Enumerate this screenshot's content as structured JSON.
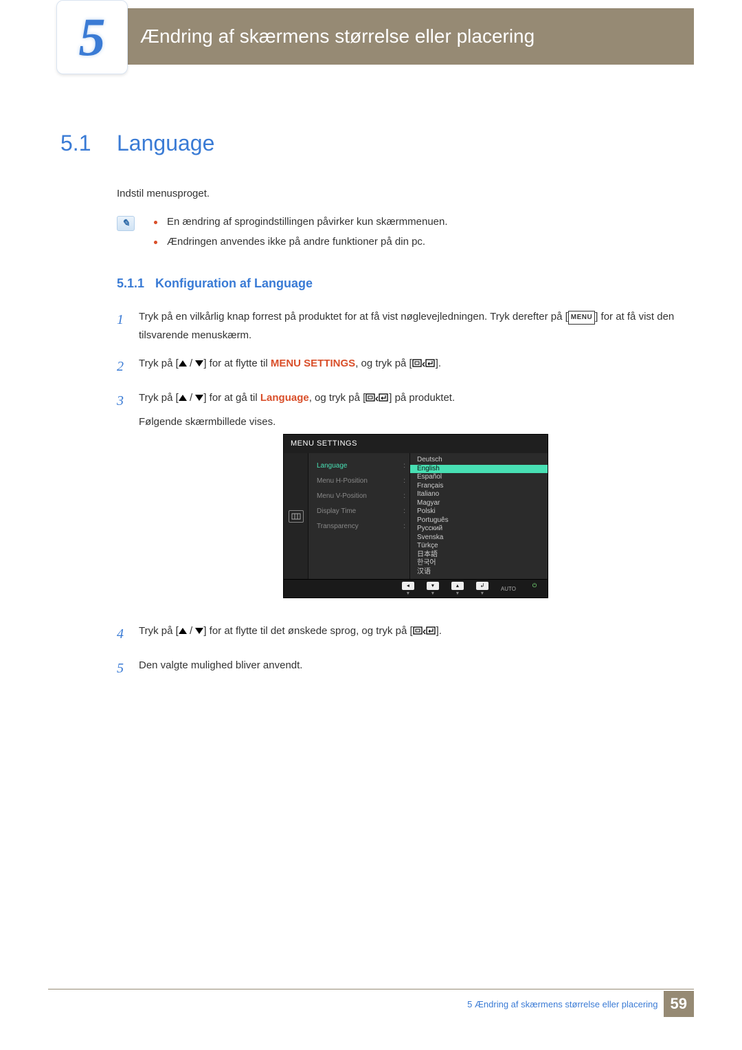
{
  "chapter": {
    "number": "5",
    "title": "Ændring af skærmens størrelse eller placering"
  },
  "section": {
    "number": "5.1",
    "title": "Language",
    "intro": "Indstil menusproget."
  },
  "notes": [
    "En ændring af sprogindstillingen påvirker kun skærmmenuen.",
    "Ændringen anvendes ikke på andre funktioner på din pc."
  ],
  "subsection": {
    "number": "5.1.1",
    "title": "Konfiguration af Language"
  },
  "steps": {
    "s1a": "Tryk på en vilkårlig knap forrest på produktet for at få vist nøglevejledningen. Tryk derefter på [",
    "s1_menu": "MENU",
    "s1b": "] for at få vist den tilsvarende menuskærm.",
    "s2a": "Tryk på [",
    "s2b": "] for at flytte til ",
    "s2_target": "MENU SETTINGS",
    "s2c": ", og tryk på [",
    "s2d": "].",
    "s3a": "Tryk på [",
    "s3b": "] for at gå til ",
    "s3_target": "Language",
    "s3c": ", og tryk på [",
    "s3d": "] på produktet.",
    "s3e": "Følgende skærmbillede vises.",
    "s4a": "Tryk på [",
    "s4b": "] for at flytte til det ønskede sprog, og tryk på [",
    "s4c": "].",
    "s5": "Den valgte mulighed bliver anvendt."
  },
  "osd": {
    "title": "MENU SETTINGS",
    "menu": [
      "Language",
      "Menu H-Position",
      "Menu V-Position",
      "Display Time",
      "Transparency"
    ],
    "langs": [
      "Deutsch",
      "English",
      "Español",
      "Français",
      "Italiano",
      "Magyar",
      "Polski",
      "Português",
      "Русский",
      "Svenska",
      "Türkçe",
      "日本語",
      "한국어",
      "汉语"
    ],
    "selected": "English",
    "auto": "AUTO"
  },
  "footer": {
    "text": "5 Ændring af skærmens størrelse eller placering",
    "page": "59"
  }
}
